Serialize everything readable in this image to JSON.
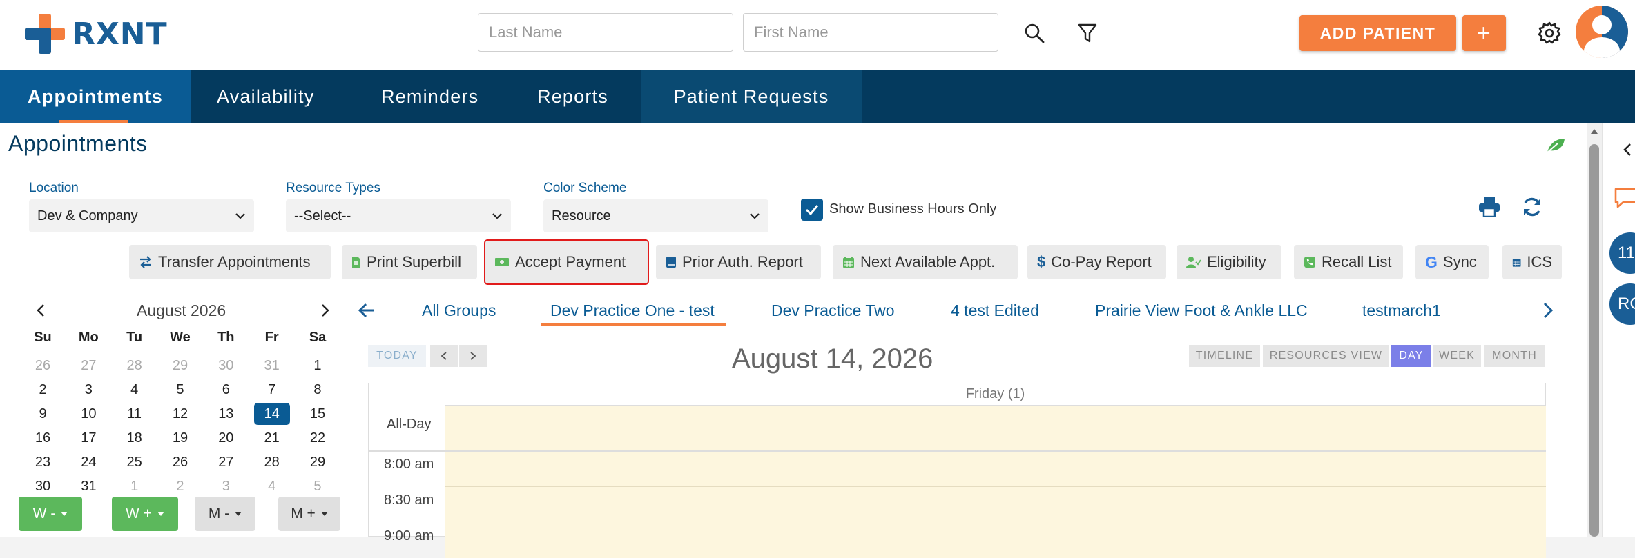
{
  "app": {
    "brand": "RXNT",
    "brand_color": "#1a5e96",
    "accent": "#f47e3e"
  },
  "header": {
    "last_name_placeholder": "Last Name",
    "first_name_placeholder": "First Name",
    "add_patient_label": "ADD PATIENT",
    "plus_label": "+"
  },
  "nav": {
    "tabs": [
      "Appointments",
      "Availability",
      "Reminders",
      "Reports",
      "Patient Requests"
    ]
  },
  "page": {
    "title": "Appointments"
  },
  "filters": {
    "location_label": "Location",
    "location_value": "Dev & Company",
    "resource_types_label": "Resource Types",
    "resource_types_value": "--Select--",
    "color_scheme_label": "Color Scheme",
    "color_scheme_value": "Resource",
    "business_hours_label": "Show Business Hours Only"
  },
  "toolbar": {
    "transfer": "Transfer Appointments",
    "superbill": "Print Superbill",
    "accept_payment": "Accept Payment",
    "prior_auth": "Prior Auth. Report",
    "next_available": "Next Available Appt.",
    "copay": "Co-Pay Report",
    "eligibility": "Eligibility",
    "recall": "Recall List",
    "sync": "Sync",
    "ics": "ICS"
  },
  "mini_calendar": {
    "month_label": "August 2026",
    "dow": [
      "Su",
      "Mo",
      "Tu",
      "We",
      "Th",
      "Fr",
      "Sa"
    ],
    "weeks": [
      [
        "26",
        "27",
        "28",
        "29",
        "30",
        "31",
        "1"
      ],
      [
        "2",
        "3",
        "4",
        "5",
        "6",
        "7",
        "8"
      ],
      [
        "9",
        "10",
        "11",
        "12",
        "13",
        "14",
        "15"
      ],
      [
        "16",
        "17",
        "18",
        "19",
        "20",
        "21",
        "22"
      ],
      [
        "23",
        "24",
        "25",
        "26",
        "27",
        "28",
        "29"
      ],
      [
        "30",
        "31",
        "1",
        "2",
        "3",
        "4",
        "5"
      ]
    ],
    "selected": "14"
  },
  "week_buttons": [
    "W -",
    "W +",
    "M -",
    "M +"
  ],
  "groups": [
    "All Groups",
    "Dev Practice One - test",
    "Dev Practice Two",
    "4 test Edited",
    "Prairie View Foot & Ankle LLC",
    "testmarch1"
  ],
  "scheduler": {
    "today_label": "TODAY",
    "date_title": "August 14, 2026",
    "views": [
      "TIMELINE",
      "RESOURCES VIEW",
      "DAY",
      "WEEK",
      "MONTH"
    ],
    "active_view": "DAY",
    "column_header": "Friday (1)",
    "all_day_label": "All-Day",
    "times": [
      "8:00 am",
      "8:30 am",
      "9:00 am"
    ]
  },
  "sidebar": {
    "badge1": "11",
    "badge2": "RC"
  }
}
